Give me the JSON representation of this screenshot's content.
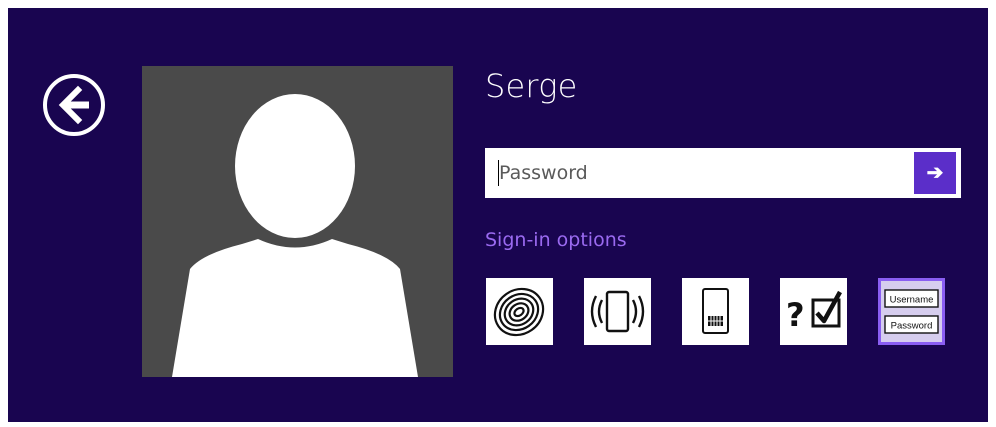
{
  "user": {
    "name": "Serge"
  },
  "password": {
    "placeholder": "Password",
    "value": ""
  },
  "submit": {
    "glyph": "➔"
  },
  "signin_options": {
    "label": "Sign-in options",
    "options": [
      {
        "name": "Fingerprint",
        "icon": "fingerprint-icon"
      },
      {
        "name": "Picture / device",
        "icon": "device-wave-icon"
      },
      {
        "name": "PIN",
        "icon": "pin-device-icon"
      },
      {
        "name": "Security question",
        "icon": "question-check-icon"
      },
      {
        "name": "Password",
        "icon": "username-password-icon",
        "selected": true
      }
    ],
    "tile_username_text": "Username",
    "tile_password_text": "Password",
    "tile_question_text": "?"
  },
  "colors": {
    "background": "#190550",
    "accent": "#5b2ec9",
    "link": "#9a6af0",
    "avatar_bg": "#4a4a4a"
  }
}
